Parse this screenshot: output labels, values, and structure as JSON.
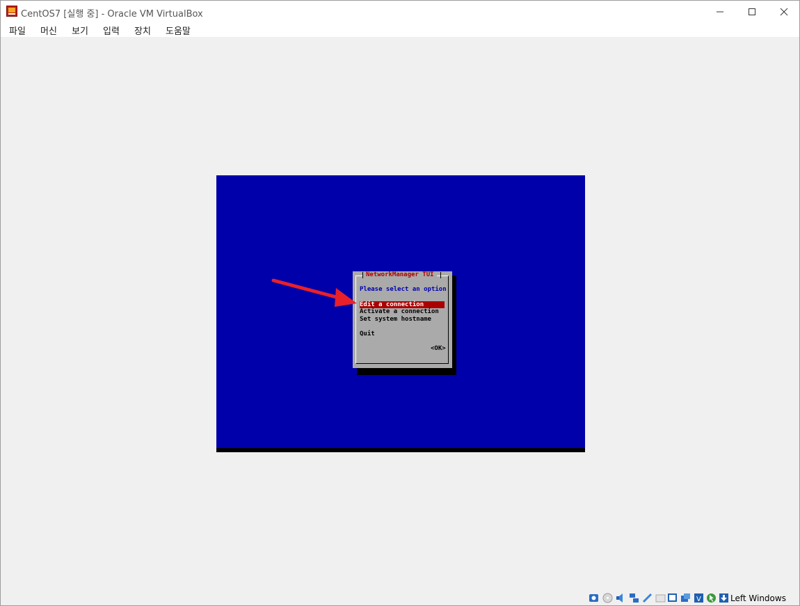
{
  "window": {
    "title": "CentOS7 [실행 중] - Oracle VM VirtualBox",
    "controls": {
      "minimize": "minimize-icon",
      "maximize": "maximize-icon",
      "close": "close-icon"
    }
  },
  "menubar": {
    "items": [
      "파일",
      "머신",
      "보기",
      "입력",
      "장치",
      "도움말"
    ]
  },
  "tui": {
    "title": "NetworkManager TUI",
    "prompt": "Please select an option",
    "options": [
      "Edit a connection",
      "Activate a connection",
      "Set system hostname"
    ],
    "quit": "Quit",
    "ok": "<OK>",
    "selected_index": 0
  },
  "colors": {
    "screen_bg": "#0000aa",
    "dialog_bg": "#aaaaaa",
    "selection": "#aa0000",
    "arrow": "#e8202a"
  },
  "statusbar": {
    "icons": [
      "hard-disk-icon",
      "optical-drive-icon",
      "audio-icon",
      "network-icon",
      "usb-icon",
      "shared-folders-icon",
      "display-icon",
      "video-capture-icon",
      "virtualization-icon",
      "mouse-integration-icon",
      "keyboard-icon"
    ],
    "host_key": "Left Windows"
  }
}
